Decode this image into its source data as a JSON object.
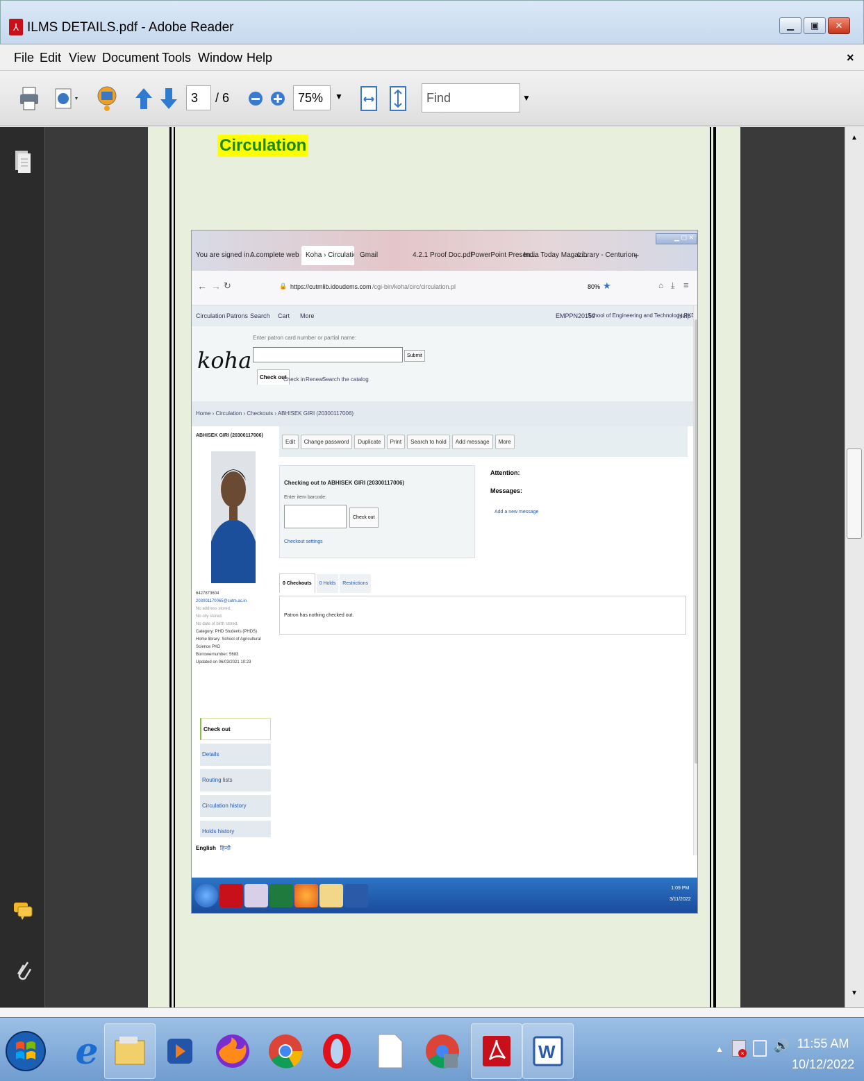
{
  "window": {
    "title": "ILMS DETAILS.pdf - Adobe Reader",
    "controls": [
      "minimize",
      "restore",
      "close"
    ]
  },
  "menu": [
    "File",
    "Edit",
    "View",
    "Document",
    "Tools",
    "Window",
    "Help"
  ],
  "toolbar": {
    "page_current": "3",
    "page_total": "/ 6",
    "zoom": "75%",
    "find_placeholder": "Find"
  },
  "doc": {
    "heading": "Circulation"
  },
  "browser": {
    "tabs": [
      "You are signed in ...",
      "A complete web enab...",
      "Koha › Circulatio",
      "Gmail",
      "4.2.1 Proof Doc.pdf",
      "PowerPoint Presen...",
      "India Today Magaz...",
      "Library - Centurion"
    ],
    "url_host": "https://cutmlib.idoudems.com",
    "url_path": "/cgi-bin/koha/circ/circulation.pl",
    "zoom": "80%"
  },
  "koha": {
    "topnav": [
      "Circulation",
      "Patrons",
      "Search",
      "Cart",
      "More"
    ],
    "user": "EMPPN20159",
    "branch": "School of Engineering and Technology PKD",
    "help": "Help",
    "logo": "koha",
    "search_hint": "Enter patron card number or partial name:",
    "submit": "Submit",
    "tabs": [
      "Check out",
      "Check in",
      "Renew",
      "Search the catalog"
    ],
    "breadcrumb": "Home › Circulation › Checkouts › ABHISEK GIRI (20300117006)",
    "patron": {
      "name": "ABHISEK GIRI (20300117006)",
      "lines": [
        "6427873604",
        "203001170065@cutm.ac.in",
        "No address stored.",
        "No city stored.",
        "No date of birth stored.",
        "Category: PHD Students (PHDS)",
        "Home library: School of Agricultural Science PKD",
        "Borrowernumber: 5683",
        "Updated on 06/03/2021 10:23"
      ]
    },
    "actions": [
      "Edit",
      "Change password",
      "Duplicate",
      "Print",
      "Search to hold",
      "Add message",
      "More"
    ],
    "checkout": {
      "title": "Checking out to ABHISEK GIRI (20300117006)",
      "label": "Enter item barcode:",
      "button": "Check out",
      "settings": "Checkout settings"
    },
    "attention": "Attention:",
    "messages": "Messages:",
    "add_message": "Add a new message",
    "list_tabs": [
      "0 Checkouts",
      "0 Holds",
      "Restrictions"
    ],
    "empty": "Patron has nothing checked out.",
    "sidenav": [
      "Check out",
      "Details",
      "Routing lists",
      "Circulation history",
      "Holds history"
    ],
    "langs": [
      "English",
      "हिन्दी"
    ],
    "inner_clock": {
      "time": "1:09 PM",
      "date": "3/11/2022"
    }
  },
  "taskbar": {
    "time": "11:55 AM",
    "date": "10/12/2022"
  }
}
